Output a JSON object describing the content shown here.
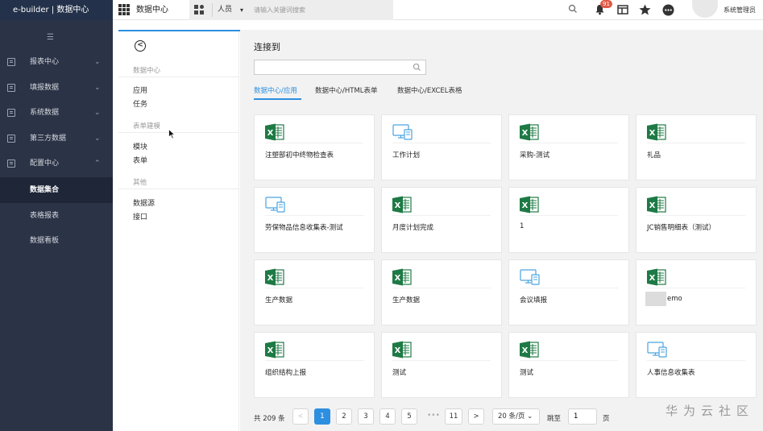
{
  "app": {
    "brand": "e-builder | 数据中心",
    "module_title": "数据中心"
  },
  "header": {
    "search_type": "人员",
    "search_placeholder": "请输入关键词搜索",
    "notification_count": "91",
    "username": "系统管理员",
    "icons": [
      "apps-grid-icon",
      "quick-menu-icon",
      "bell-icon",
      "layout-icon",
      "star-icon",
      "more-icon",
      "search-icon"
    ]
  },
  "sidebar": {
    "items": [
      {
        "label": "报表中心",
        "expanded": false
      },
      {
        "label": "填报数据",
        "expanded": false
      },
      {
        "label": "系统数据",
        "expanded": false
      },
      {
        "label": "第三方数据",
        "expanded": false
      },
      {
        "label": "配置中心",
        "expanded": true
      }
    ],
    "subitems": [
      {
        "label": "数据集合",
        "active": true
      },
      {
        "label": "表格报表",
        "active": false
      },
      {
        "label": "数据看板",
        "active": false
      }
    ]
  },
  "left_panel": {
    "sections": [
      {
        "heading": "数据中心",
        "links": [
          "应用",
          "任务"
        ]
      },
      {
        "heading": "表单建模",
        "links": [
          "模块",
          "表单"
        ]
      },
      {
        "heading": "其他",
        "links": [
          "数据源",
          "接口"
        ]
      }
    ]
  },
  "main": {
    "title": "连接到",
    "search_placeholder": "",
    "tabs": [
      {
        "label": "数据中心/应用",
        "active": true
      },
      {
        "label": "数据中心/HTML表单",
        "active": false
      },
      {
        "label": "数据中心/EXCEL表格",
        "active": false
      }
    ],
    "cards": [
      {
        "label": "注塑部初中终物检查表",
        "icon": "excel-icon"
      },
      {
        "label": "工作计划",
        "icon": "monitor-form-icon"
      },
      {
        "label": "采购-测试",
        "icon": "excel-icon"
      },
      {
        "label": "礼品",
        "icon": "excel-icon"
      },
      {
        "label": "劳保物品信息收集表-测试",
        "icon": "monitor-form-icon"
      },
      {
        "label": "月度计划完成",
        "icon": "excel-icon"
      },
      {
        "label": "1",
        "icon": "excel-icon"
      },
      {
        "label": "JC销售明细表（测试）",
        "icon": "excel-icon"
      },
      {
        "label": "生产数据",
        "icon": "excel-icon"
      },
      {
        "label": "生产数据",
        "icon": "excel-icon"
      },
      {
        "label": "会议填报",
        "icon": "monitor-form-icon"
      },
      {
        "label": "emo",
        "icon": "excel-icon",
        "redacted_prefix": true
      },
      {
        "label": "组织结构上报",
        "icon": "excel-icon"
      },
      {
        "label": "测试",
        "icon": "excel-icon"
      },
      {
        "label": "测试",
        "icon": "excel-icon"
      },
      {
        "label": "人事信息收集表",
        "icon": "monitor-form-icon"
      }
    ]
  },
  "pagination": {
    "total_text": "共 209 条",
    "prev": "<",
    "pages": [
      "1",
      "2",
      "3",
      "4",
      "5"
    ],
    "ellipsis": "•••",
    "last_page": "11",
    "next": ">",
    "current_page": "1",
    "page_size": "20 条/页",
    "jump_label": "跳至",
    "jump_value": "1",
    "page_suffix": "页"
  },
  "watermark": "华为云社区",
  "colors": {
    "accent": "#2d8fe0",
    "sidebar": "#2b3346",
    "excel_green": "#1e7a45",
    "badge": "#e05a45"
  }
}
